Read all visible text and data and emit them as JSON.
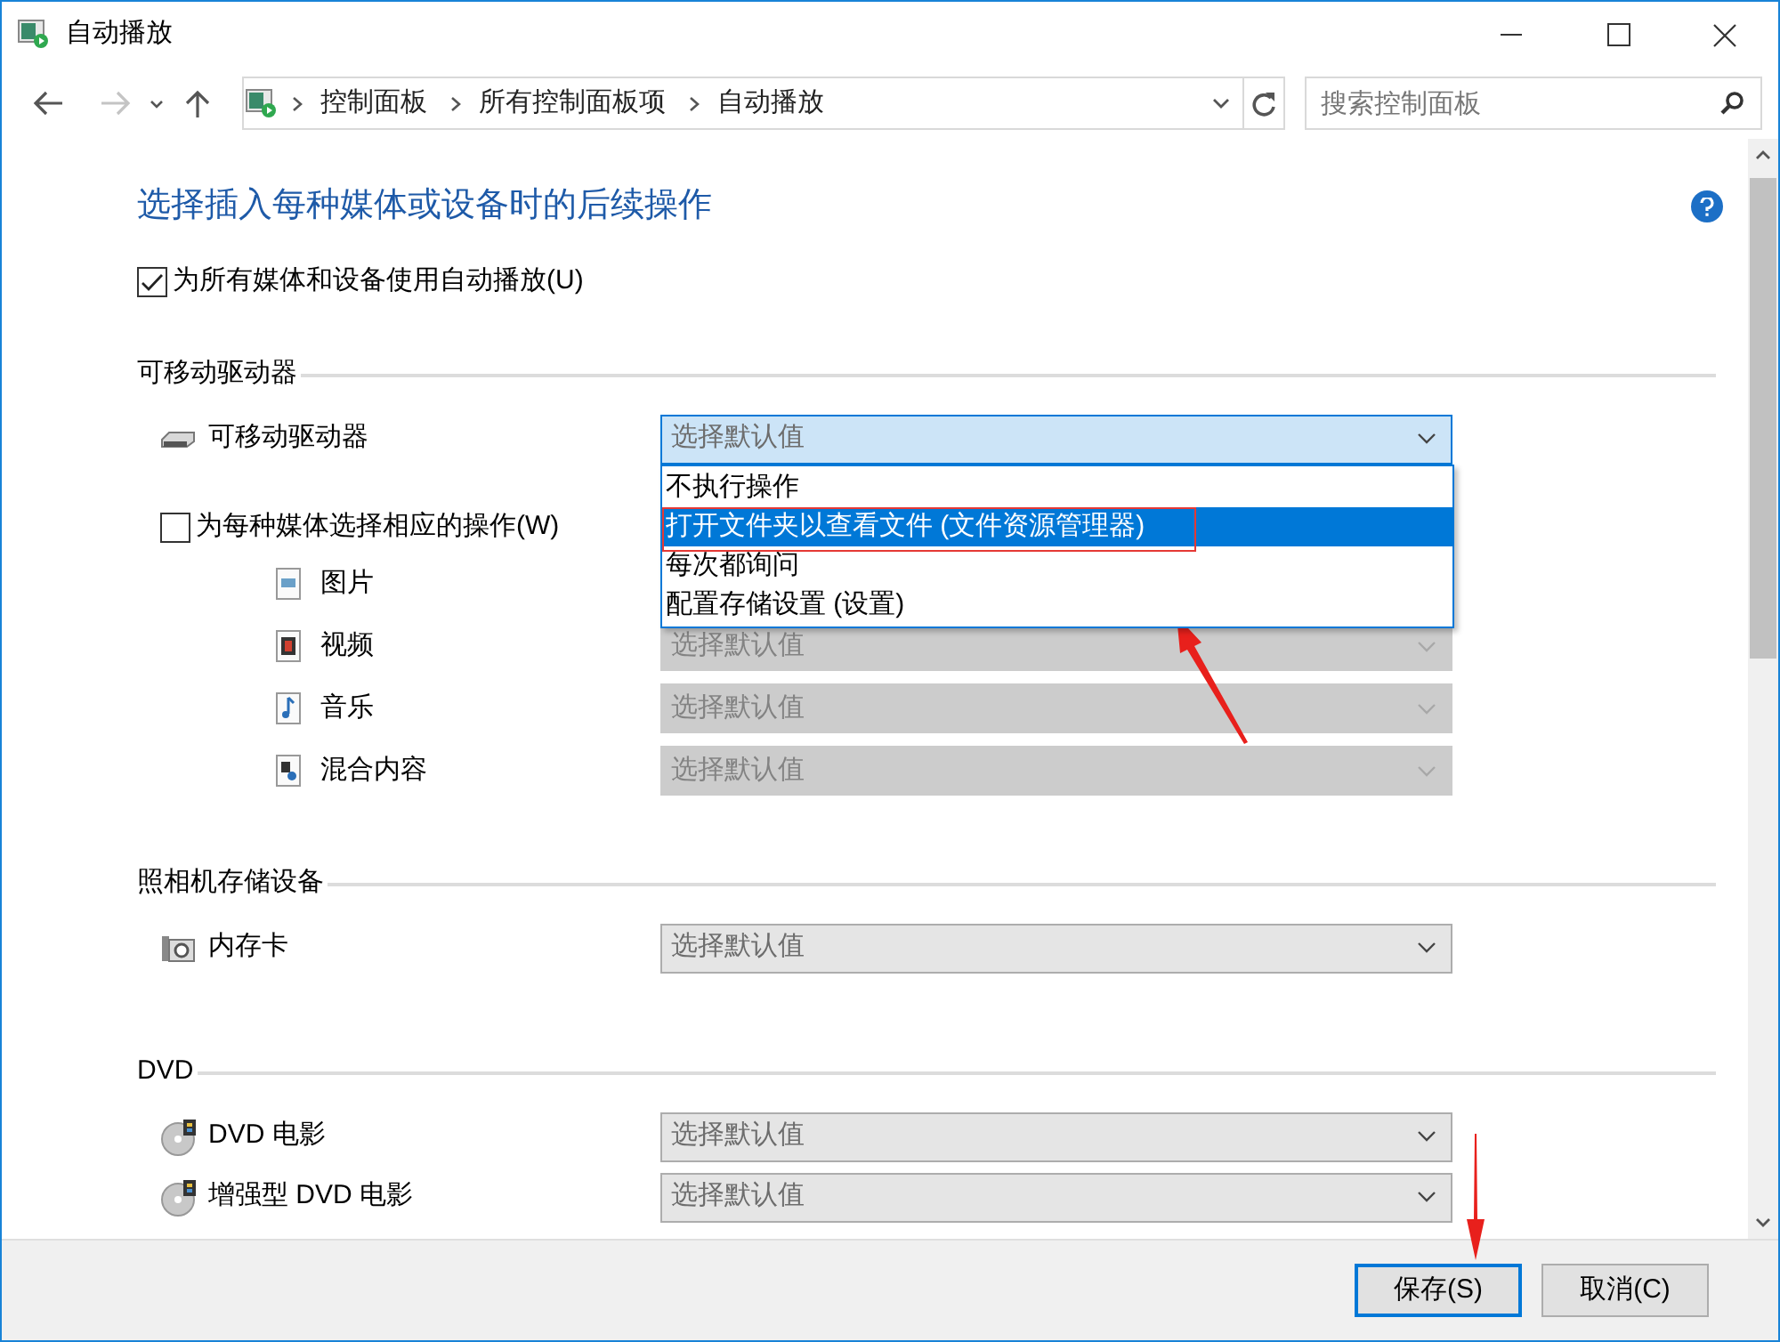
{
  "window": {
    "title": "自动播放"
  },
  "nav": {
    "breadcrumb": [
      "控制面板",
      "所有控制面板项",
      "自动播放"
    ],
    "search": {
      "placeholder": "搜索控制面板"
    }
  },
  "heading": "选择插入每种媒体或设备时的后续操作",
  "autoplay_all": {
    "label": "为所有媒体和设备使用自动播放(U)",
    "checked": true
  },
  "sections": [
    {
      "title": "可移动驱动器",
      "items": [
        {
          "kind": "device",
          "label": "可移动驱动器",
          "select": {
            "value": "选择默认值",
            "disabled": false,
            "open": true,
            "options": [
              {
                "label": "不执行操作",
                "selected": false
              },
              {
                "label": "打开文件夹以查看文件 (文件资源管理器)",
                "selected": true
              },
              {
                "label": "每次都询问",
                "selected": false
              },
              {
                "label": "配置存储设置 (设置)",
                "selected": false
              }
            ]
          }
        },
        {
          "kind": "checkbox",
          "label": "为每种媒体选择相应的操作(W)",
          "checked": false
        },
        {
          "kind": "media",
          "label": "图片"
        },
        {
          "kind": "media",
          "label": "视频",
          "select": {
            "value": "选择默认值",
            "disabled": true,
            "open": false
          }
        },
        {
          "kind": "media",
          "label": "音乐",
          "select": {
            "value": "选择默认值",
            "disabled": true,
            "open": false
          }
        },
        {
          "kind": "media",
          "label": "混合内容",
          "select": {
            "value": "选择默认值",
            "disabled": true,
            "open": false
          }
        }
      ]
    },
    {
      "title": "照相机存储设备",
      "items": [
        {
          "kind": "device",
          "label": "内存卡",
          "select": {
            "value": "选择默认值",
            "disabled": false,
            "open": false
          }
        }
      ]
    },
    {
      "title": "DVD",
      "items": [
        {
          "kind": "device",
          "label": "DVD 电影",
          "select": {
            "value": "选择默认值",
            "disabled": false,
            "open": false
          }
        },
        {
          "kind": "device",
          "label": "增强型 DVD 电影",
          "select": {
            "value": "选择默认值",
            "disabled": false,
            "open": false
          }
        }
      ]
    }
  ],
  "buttons": [
    {
      "label": "保存(S)",
      "focused": true
    },
    {
      "label": "取消(C)",
      "focused": false
    }
  ]
}
